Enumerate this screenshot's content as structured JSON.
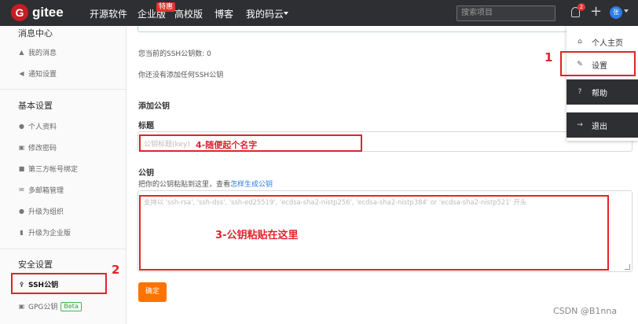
{
  "header": {
    "logo_mark": "G",
    "logo_text": "gitee",
    "nav": [
      "开源软件",
      "企业版",
      "高校版",
      "博客",
      "我的码云"
    ],
    "hot_badge": "特惠",
    "search_placeholder": "搜索项目",
    "notification_count": "2",
    "avatar_text": "张"
  },
  "sidebar": {
    "section_messages": "消息中心",
    "my_messages": "我的消息",
    "notification_settings": "通知设置",
    "section_basic": "基本设置",
    "profile": "个人资料",
    "change_password": "修改密码",
    "third_party": "第三方帐号绑定",
    "emails": "多邮箱管理",
    "upgrade_org": "升级为组织",
    "upgrade_enterprise": "升级为企业版",
    "section_security": "安全设置",
    "ssh_keys": "SSH公钥",
    "gpg_keys": "GPG公钥",
    "beta": "Beta"
  },
  "main": {
    "ssh_count": "您当前的SSH公钥数: 0",
    "no_keys": "你还没有添加任何SSH公钥",
    "add_key": "添加公钥",
    "title_label": "标题",
    "title_placeholder": "公钥标题(key)",
    "key_label": "公钥",
    "key_hint": "把你的公钥粘贴到这里，查看",
    "key_hint_link": "怎样生成公钥",
    "key_placeholder": "支持以 'ssh-rsa', 'ssh-dss', 'ssh-ed25519', 'ecdsa-sha2-nistp256', 'ecdsa-sha2-nistp384' or 'ecdsa-sha2-nistp521' 开头",
    "confirm": "确定"
  },
  "dropdown": {
    "home": "个人主页",
    "settings": "设置",
    "help": "帮助",
    "logout": "退出"
  },
  "annotations": {
    "step1": "1",
    "step2": "2",
    "step3": "3-公钥粘贴在这里",
    "step4": "4-随便起个名字"
  },
  "watermark": "CSDN @B1nna",
  "colors": {
    "topbar": "#2e2f32",
    "brand": "#c71d23",
    "button": "#fe7300",
    "annotation": "#e0242c",
    "link": "#2b7de9"
  }
}
